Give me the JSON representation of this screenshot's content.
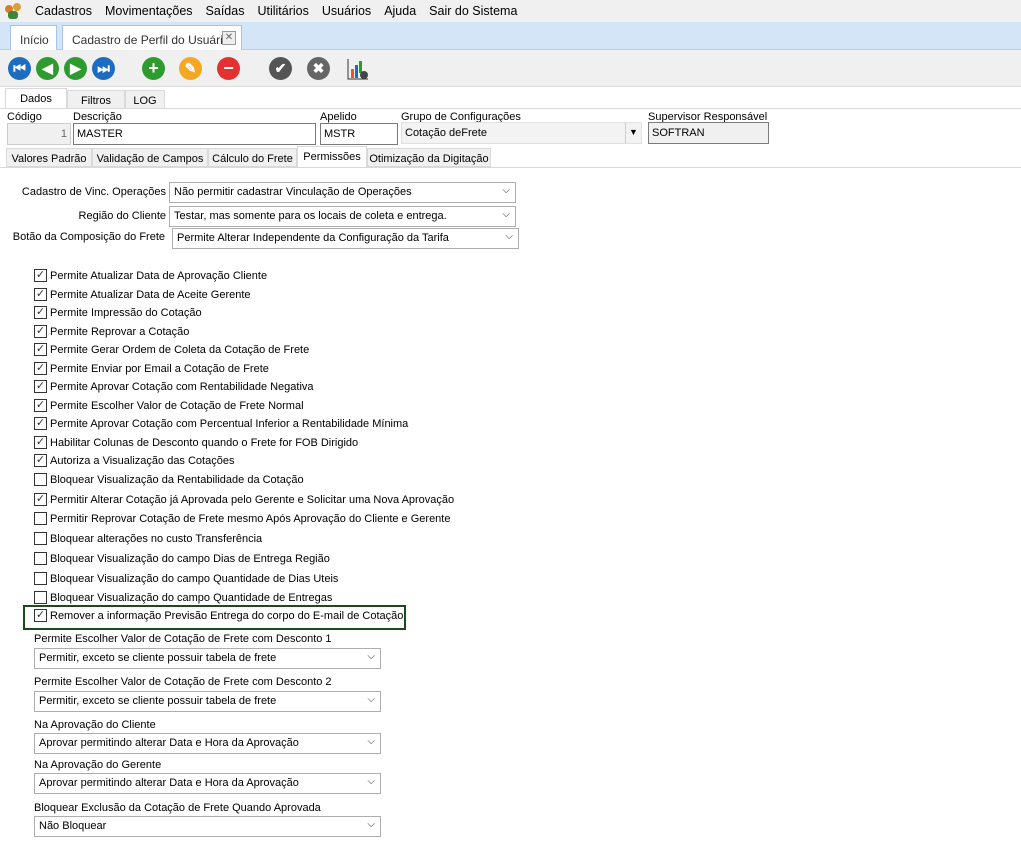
{
  "menu": [
    "Cadastros",
    "Movimentações",
    "Saídas",
    "Utilitários",
    "Usuários",
    "Ajuda",
    "Sair do Sistema"
  ],
  "window_tabs": {
    "home": "Início",
    "active": "Cadastro de Perfil do Usuário"
  },
  "toolbar": [
    "first",
    "previous",
    "next",
    "last",
    "add",
    "edit",
    "delete",
    "confirm",
    "cancel",
    "report-settings"
  ],
  "main_tabs": [
    "Dados",
    "Filtros",
    "LOG"
  ],
  "fields": {
    "codigo_label": "Código",
    "codigo": "1",
    "descricao_label": "Descrição",
    "descricao": "MASTER",
    "apelido_label": "Apelido",
    "apelido": "MSTR",
    "grupo_label": "Grupo de Configurações",
    "grupo": "Cotação deFrete",
    "supervisor_label": "Supervisor Responsável",
    "supervisor": "SOFTRAN"
  },
  "sub_tabs": [
    "Valores Padrão",
    "Validação de Campos",
    "Cálculo do Frete",
    "Permissões",
    "Otimização da Digitação"
  ],
  "selects": [
    {
      "label": "Cadastro de Vinc. Operações",
      "value": "Não permitir cadastrar Vinculação de Operações"
    },
    {
      "label": "Região do Cliente",
      "value": "Testar, mas somente para os locais de coleta e entrega."
    },
    {
      "label": "Botão da Composição do Frete",
      "value": "Permite Alterar Independente da Configuração da Tarifa"
    }
  ],
  "checkboxes": [
    {
      "label": "Permite Atualizar Data de Aprovação Cliente",
      "checked": true
    },
    {
      "label": "Permite Atualizar Data de Aceite Gerente",
      "checked": true
    },
    {
      "label": "Permite Impressão do Cotação",
      "checked": true
    },
    {
      "label": "Permite Reprovar a Cotação",
      "checked": true
    },
    {
      "label": "Permite Gerar Ordem de Coleta da Cotação de Frete",
      "checked": true
    },
    {
      "label": "Permite Enviar por Email a Cotação de Frete",
      "checked": true
    },
    {
      "label": "Permite Aprovar Cotação com Rentabilidade Negativa",
      "checked": true
    },
    {
      "label": "Permite Escolher Valor de Cotação de Frete Normal",
      "checked": true
    },
    {
      "label": "Permite Aprovar Cotação com Percentual Inferior a Rentabilidade Mínima",
      "checked": true
    },
    {
      "label": "Habilitar Colunas de Desconto quando o Frete for FOB Dirigido",
      "checked": true
    },
    {
      "label": "Autoriza a Visualização das Cotações",
      "checked": true
    },
    {
      "label": "Bloquear Visualização da Rentabilidade da Cotação",
      "checked": false
    },
    {
      "label": "Permitir Alterar Cotação já Aprovada pelo Gerente e Solicitar uma Nova Aprovação",
      "checked": true
    },
    {
      "label": "Permitir Reprovar Cotação de Frete mesmo Após Aprovação do Cliente e Gerente",
      "checked": false
    },
    {
      "label": "Bloquear alterações no custo Transferência",
      "checked": false
    },
    {
      "label": "Bloquear Visualização do campo Dias de Entrega Região",
      "checked": false
    },
    {
      "label": "Bloquear Visualização do campo Quantidade de Dias Uteis",
      "checked": false
    },
    {
      "label": "Bloquear Visualização do campo Quantidade de Entregas",
      "checked": false
    },
    {
      "label": "Remover a informação Previsão Entrega do corpo do E-mail de Cotação",
      "checked": true
    }
  ],
  "bottom_selects": [
    {
      "label": "Permite Escolher Valor de Cotação de Frete com Desconto 1",
      "value": "Permitir, exceto se cliente possuir tabela de frete"
    },
    {
      "label": "Permite Escolher Valor de Cotação de Frete com Desconto 2",
      "value": "Permitir, exceto se cliente possuir tabela de frete"
    },
    {
      "label": "Na Aprovação do Cliente",
      "value": "Aprovar permitindo alterar Data e Hora da Aprovação"
    },
    {
      "label": "Na Aprovação do Gerente",
      "value": "Aprovar permitindo alterar Data e Hora da Aprovação"
    },
    {
      "label": "Bloquear Exclusão da Cotação de Frete Quando Aprovada",
      "value": "Não Bloquear"
    }
  ]
}
